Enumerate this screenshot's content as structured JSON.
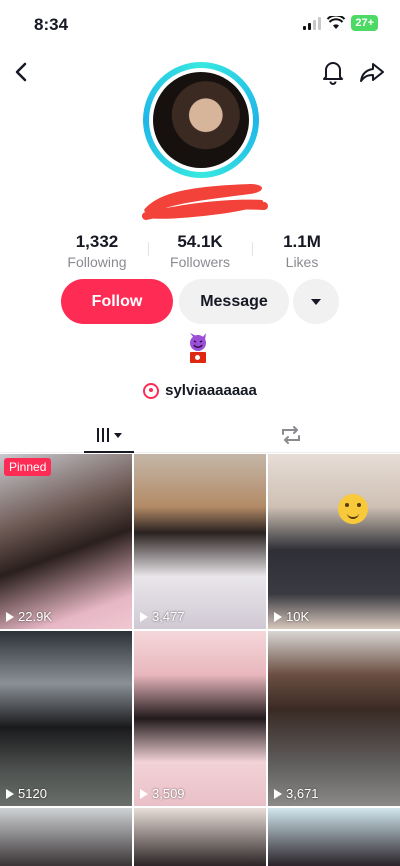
{
  "status_bar": {
    "time": "8:34",
    "battery": "27+"
  },
  "profile": {
    "stats": [
      {
        "value": "1,332",
        "label": "Following"
      },
      {
        "value": "54.1K",
        "label": "Followers"
      },
      {
        "value": "1.1M",
        "label": "Likes"
      }
    ],
    "follow_label": "Follow",
    "message_label": "Message",
    "bio_link": "sylviaaaaaaa"
  },
  "videos": [
    {
      "views": "22.9K",
      "pinned": "Pinned"
    },
    {
      "views": "3,477"
    },
    {
      "views": "10K"
    },
    {
      "views": "5120"
    },
    {
      "views": "3,509"
    },
    {
      "views": "3,671"
    }
  ],
  "icons": {
    "back": "chevron-left-icon",
    "bell": "bell-icon",
    "share": "share-arrow-icon",
    "videos_tab": "grid-icon",
    "repost_tab": "repost-icon",
    "bio_emoji": "smiling-devil-emoji",
    "bio_flag": "hong-kong-flag"
  },
  "colors": {
    "accent": "#fe2c55",
    "avatar_ring": "#38e8e0"
  }
}
